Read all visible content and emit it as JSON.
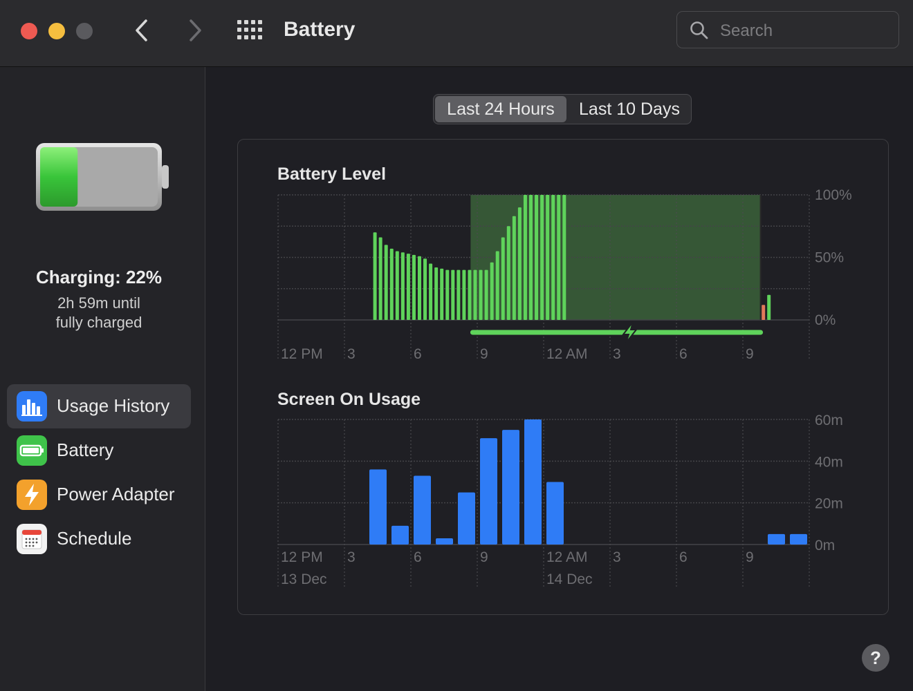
{
  "window": {
    "title": "Battery",
    "search_placeholder": "Search"
  },
  "sidebar": {
    "charging_status": "Charging: 22%",
    "time_line1": "2h 59m until",
    "time_line2": "fully charged",
    "battery_percent": 22,
    "items": [
      {
        "label": "Usage History",
        "icon": "bar-chart-icon",
        "color": "#2f7cf6",
        "active": true
      },
      {
        "label": "Battery",
        "icon": "battery-icon",
        "color": "#3fc34a",
        "active": false
      },
      {
        "label": "Power Adapter",
        "icon": "lightning-icon",
        "color": "#f3a12c",
        "active": false
      },
      {
        "label": "Schedule",
        "icon": "calendar-icon",
        "color": "#f2f2f2",
        "active": false
      }
    ]
  },
  "range_tabs": {
    "options": [
      "Last 24 Hours",
      "Last 10 Days"
    ],
    "selected": "Last 24 Hours"
  },
  "chart_data": [
    {
      "type": "bar",
      "title": "Battery Level",
      "ylim": [
        0,
        100
      ],
      "y_ticks": [
        "100%",
        "50%",
        "0%"
      ],
      "x_ticks": [
        "12 PM",
        "3",
        "6",
        "9",
        "12 AM",
        "3",
        "6",
        "9"
      ],
      "colors": {
        "bar": "#5fd35b",
        "low": "#e2795a",
        "charging_band": "#3f6b3c",
        "charging_line": "#5fd35b"
      },
      "values": [
        70,
        66,
        60,
        57,
        55,
        54,
        53,
        52,
        51,
        49,
        45,
        42,
        41,
        40,
        40,
        40,
        40,
        40,
        40,
        40,
        40,
        46,
        55,
        66,
        75,
        83,
        90,
        100,
        100,
        100,
        100,
        100,
        100,
        100,
        100
      ],
      "late_values": [
        {
          "value": 12,
          "low": true
        },
        {
          "value": 20,
          "low": false
        }
      ],
      "charging_period": {
        "start_hour": 8.7,
        "end_hour": 21.8
      }
    },
    {
      "type": "bar",
      "title": "Screen On Usage",
      "ylim": [
        0,
        60
      ],
      "y_ticks": [
        "60m",
        "40m",
        "20m",
        "0m"
      ],
      "x_ticks": [
        "12 PM",
        "3",
        "6",
        "9",
        "12 AM",
        "3",
        "6",
        "9"
      ],
      "date_labels": [
        {
          "label": "13 Dec",
          "at_hour": 0
        },
        {
          "label": "14 Dec",
          "at_hour": 12
        }
      ],
      "color": "#2f7cf6",
      "values": [
        0,
        0,
        0,
        0,
        36,
        9,
        33,
        3,
        25,
        51,
        55,
        60,
        30,
        0,
        0,
        0,
        0,
        0,
        0,
        0,
        0,
        0,
        5,
        5
      ]
    }
  ],
  "help_label": "?"
}
